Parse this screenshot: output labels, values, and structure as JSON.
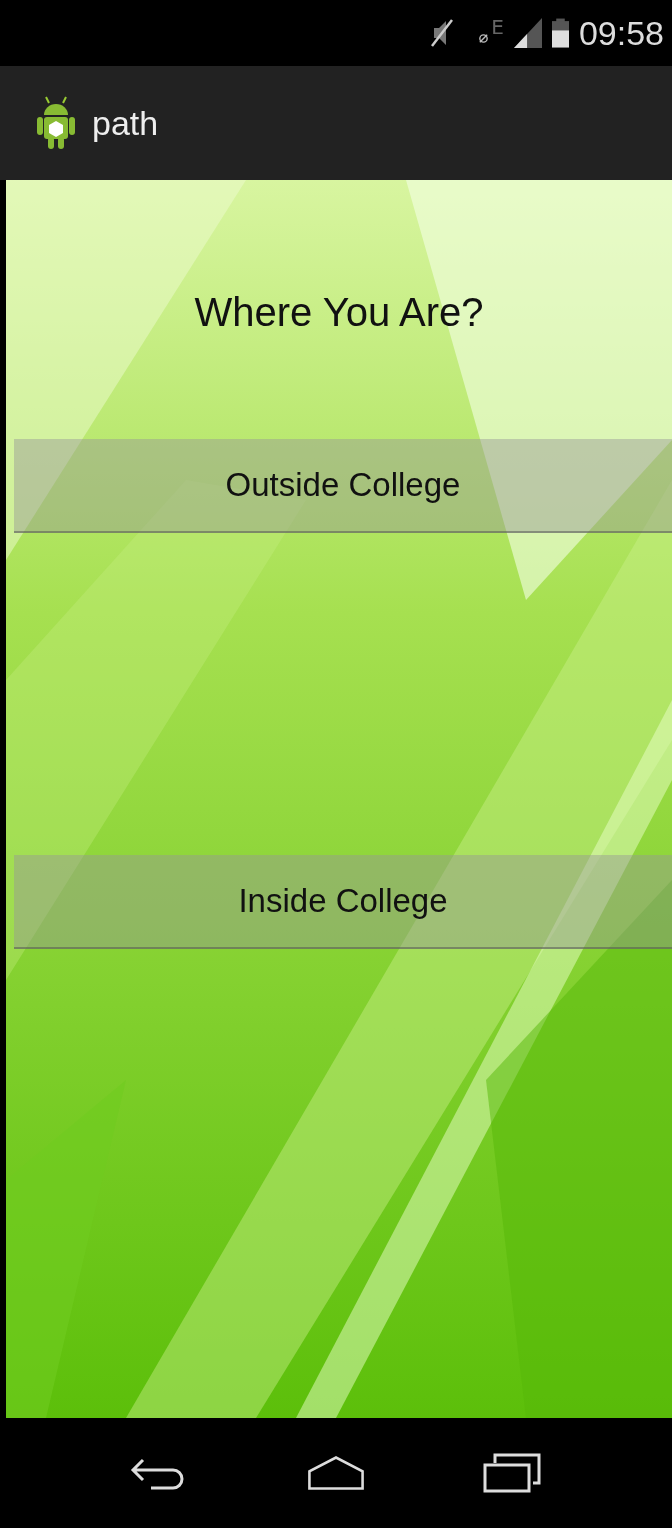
{
  "status_bar": {
    "time": "09:58",
    "network_type": "E"
  },
  "app_bar": {
    "title": "path"
  },
  "content": {
    "heading": "Where You Are?",
    "buttons": [
      {
        "label": "Outside College"
      },
      {
        "label": "Inside College"
      }
    ]
  }
}
